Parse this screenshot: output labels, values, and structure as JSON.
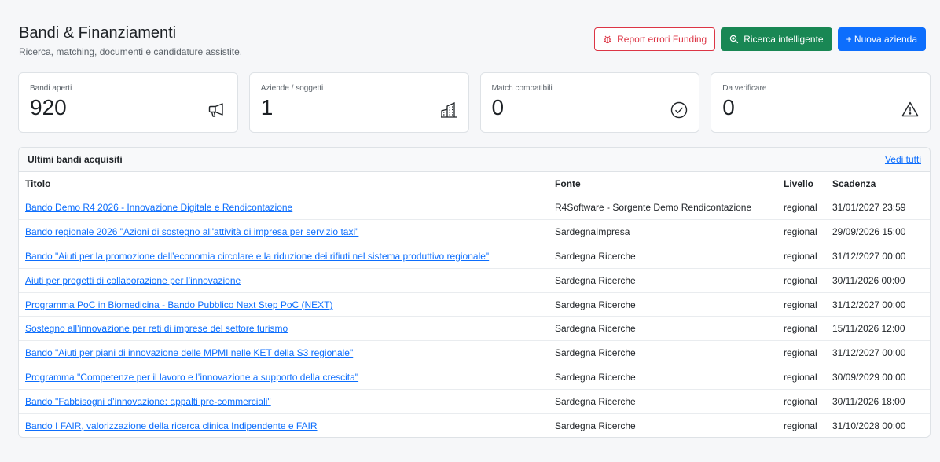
{
  "header": {
    "title": "Bandi & Finanziamenti",
    "subtitle": "Ricerca, matching, documenti e candidature assistite."
  },
  "actions": {
    "report_label": "Report errori Funding",
    "search_label": "Ricerca intelligente",
    "new_label": "+ Nuova azienda"
  },
  "stats": [
    {
      "label": "Bandi aperti",
      "value": "920",
      "icon": "megaphone-icon"
    },
    {
      "label": "Aziende / soggetti",
      "value": "1",
      "icon": "buildings-icon"
    },
    {
      "label": "Match compatibili",
      "value": "0",
      "icon": "check-circle-icon"
    },
    {
      "label": "Da verificare",
      "value": "0",
      "icon": "warning-triangle-icon"
    }
  ],
  "table_card": {
    "title": "Ultimi bandi acquisiti",
    "view_all": "Vedi tutti",
    "columns": [
      "Titolo",
      "Fonte",
      "Livello",
      "Scadenza"
    ],
    "rows": [
      [
        "Bando Demo R4 2026 - Innovazione Digitale e Rendicontazione",
        "R4Software - Sorgente Demo Rendicontazione",
        "regional",
        "31/01/2027 23:59"
      ],
      [
        "Bando regionale 2026 \"Azioni di sostegno all'attività di impresa per servizio taxi\"",
        "SardegnaImpresa",
        "regional",
        "29/09/2026 15:00"
      ],
      [
        "Bando \"Aiuti per la promozione dell’economia circolare e la riduzione dei rifiuti nel sistema produttivo regionale\"",
        "Sardegna Ricerche",
        "regional",
        "31/12/2027 00:00"
      ],
      [
        "Aiuti per progetti di collaborazione per l’innovazione",
        "Sardegna Ricerche",
        "regional",
        "30/11/2026 00:00"
      ],
      [
        "Programma PoC in Biomedicina - Bando Pubblico Next Step PoC (NEXT)",
        "Sardegna Ricerche",
        "regional",
        "31/12/2027 00:00"
      ],
      [
        "Sostegno all’innovazione per reti di imprese del settore turismo",
        "Sardegna Ricerche",
        "regional",
        "15/11/2026 12:00"
      ],
      [
        "Bando \"Aiuti per piani di innovazione delle MPMI nelle KET della S3 regionale\"",
        "Sardegna Ricerche",
        "regional",
        "31/12/2027 00:00"
      ],
      [
        "Programma \"Competenze per il lavoro e l’innovazione a supporto della crescita\"",
        "Sardegna Ricerche",
        "regional",
        "30/09/2029 00:00"
      ],
      [
        "Bando \"Fabbisogni d’innovazione: appalti pre-commerciali\"",
        "Sardegna Ricerche",
        "regional",
        "30/11/2026 18:00"
      ],
      [
        "Bando I FAIR, valorizzazione della ricerca clinica Indipendente e FAIR",
        "Sardegna Ricerche",
        "regional",
        "31/10/2028 00:00"
      ]
    ]
  }
}
